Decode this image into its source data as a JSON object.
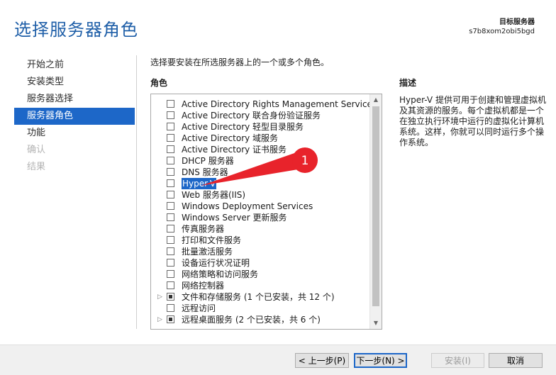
{
  "page": {
    "title": "选择服务器角色"
  },
  "target": {
    "label": "目标服务器",
    "server": "s7b8xom2obi5bgd"
  },
  "nav": {
    "items": [
      {
        "label": "开始之前",
        "state": "normal"
      },
      {
        "label": "安装类型",
        "state": "normal"
      },
      {
        "label": "服务器选择",
        "state": "normal"
      },
      {
        "label": "服务器角色",
        "state": "active"
      },
      {
        "label": "功能",
        "state": "normal"
      },
      {
        "label": "确认",
        "state": "disabled"
      },
      {
        "label": "结果",
        "state": "disabled"
      }
    ]
  },
  "main": {
    "instruction": "选择要安装在所选服务器上的一个或多个角色。",
    "roles_heading": "角色",
    "roles": [
      {
        "label": "Active Directory Rights Management Services",
        "state": "unchecked",
        "expandable": false
      },
      {
        "label": "Active Directory 联合身份验证服务",
        "state": "unchecked",
        "expandable": false
      },
      {
        "label": "Active Directory 轻型目录服务",
        "state": "unchecked",
        "expandable": false
      },
      {
        "label": "Active Directory 域服务",
        "state": "unchecked",
        "expandable": false
      },
      {
        "label": "Active Directory 证书服务",
        "state": "unchecked",
        "expandable": false
      },
      {
        "label": "DHCP 服务器",
        "state": "unchecked",
        "expandable": false
      },
      {
        "label": "DNS 服务器",
        "state": "unchecked",
        "expandable": false
      },
      {
        "label": "Hyper-V",
        "state": "unchecked",
        "expandable": false,
        "selected": true
      },
      {
        "label": "Web 服务器(IIS)",
        "state": "unchecked",
        "expandable": false
      },
      {
        "label": "Windows Deployment Services",
        "state": "unchecked",
        "expandable": false
      },
      {
        "label": "Windows Server 更新服务",
        "state": "unchecked",
        "expandable": false
      },
      {
        "label": "传真服务器",
        "state": "unchecked",
        "expandable": false
      },
      {
        "label": "打印和文件服务",
        "state": "unchecked",
        "expandable": false
      },
      {
        "label": "批量激活服务",
        "state": "unchecked",
        "expandable": false
      },
      {
        "label": "设备运行状况证明",
        "state": "unchecked",
        "expandable": false
      },
      {
        "label": "网络策略和访问服务",
        "state": "unchecked",
        "expandable": false
      },
      {
        "label": "网络控制器",
        "state": "unchecked",
        "expandable": false
      },
      {
        "label": "文件和存储服务 (1 个已安装，共 12 个)",
        "state": "partial",
        "expandable": true
      },
      {
        "label": "远程访问",
        "state": "unchecked",
        "expandable": false
      },
      {
        "label": "远程桌面服务 (2 个已安装，共 6 个)",
        "state": "partial",
        "expandable": true
      }
    ],
    "description_heading": "描述",
    "description": "Hyper-V 提供可用于创建和管理虚拟机及其资源的服务。每个虚拟机都是一个在独立执行环境中运行的虚拟化计算机系统。这样，你就可以同时运行多个操作系统。"
  },
  "annotation": {
    "number": "1",
    "color": "#e8232b"
  },
  "footer": {
    "prev": "< 上一步(P)",
    "next": "下一步(N) >",
    "install": "安装(I)",
    "cancel": "取消"
  },
  "colors": {
    "accent": "#1d67c8",
    "title": "#1f5fa8"
  }
}
